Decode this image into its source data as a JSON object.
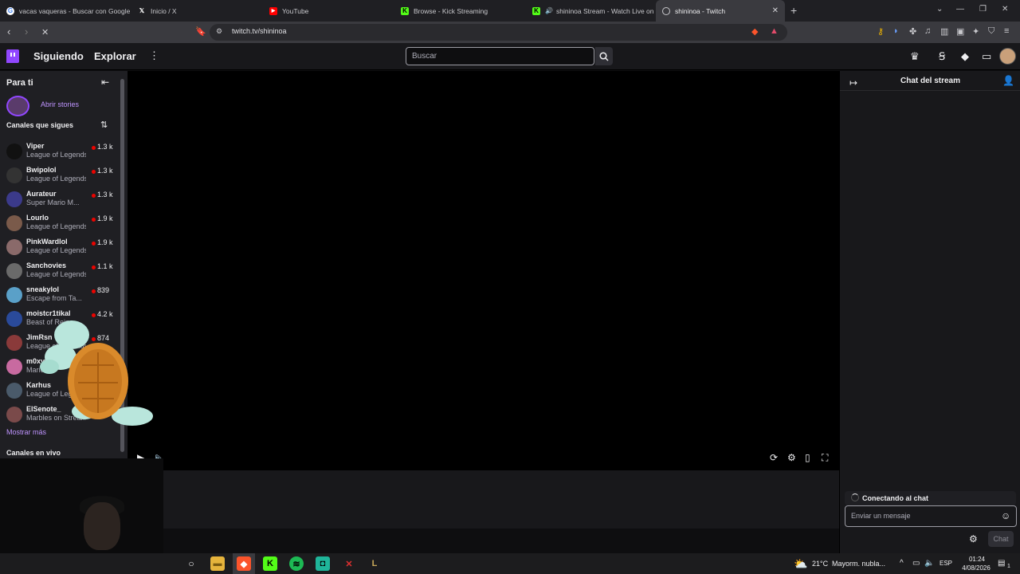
{
  "browser": {
    "tabs": [
      {
        "title": "vacas vaqueras - Buscar con Google",
        "icon": "google-icon",
        "color": "#4285f4"
      },
      {
        "title": "Inicio / X",
        "icon": "x-icon",
        "color": "#ffffff"
      },
      {
        "title": "YouTube",
        "icon": "youtube-icon",
        "color": "#ff0000"
      },
      {
        "title": "Browse - Kick Streaming",
        "icon": "kick-icon",
        "color": "#53fc18"
      },
      {
        "title": "shininoa Stream - Watch Live on",
        "icon": "kick-icon",
        "color": "#53fc18"
      },
      {
        "title": "shininoa - Twitch",
        "icon": "loading-icon",
        "color": "#c8c8cc"
      }
    ],
    "url": "twitch.tv/shininoa"
  },
  "nav": {
    "following": "Siguiendo",
    "explore": "Explorar",
    "search_placeholder": "Buscar"
  },
  "sidebar": {
    "title": "Para ti",
    "stories": "Abrir stories",
    "following_title": "Canales que sigues",
    "channels": [
      {
        "name": "Viper",
        "game": "League of Legends",
        "viewers": "1.3 k",
        "avatar_color": "#111111"
      },
      {
        "name": "Bwipolol",
        "game": "League of Legends",
        "viewers": "1.3 k",
        "avatar_color": "#333333"
      },
      {
        "name": "Aurateur",
        "game": "Super Mario M...",
        "viewers": "1.3 k",
        "avatar_color": "#3b3a8a"
      },
      {
        "name": "Lourlo",
        "game": "League of Legends",
        "viewers": "1.9 k",
        "avatar_color": "#7a5a4a"
      },
      {
        "name": "PinkWardlol",
        "game": "League of Legends",
        "viewers": "1.9 k",
        "avatar_color": "#8a6a6a"
      },
      {
        "name": "Sanchovies",
        "game": "League of Legends",
        "viewers": "1.1 k",
        "avatar_color": "#6a6a6a"
      },
      {
        "name": "sneakylol",
        "game": "Escape from Ta...",
        "viewers": "839",
        "avatar_color": "#5aa0c8"
      },
      {
        "name": "moistcr1tikal",
        "game": "Beast of Reinc...",
        "viewers": "4.2 k",
        "avatar_color": "#2a4a9a"
      },
      {
        "name": "JimRsn",
        "game": "League of Legends",
        "viewers": "874",
        "avatar_color": "#8a3a3a"
      },
      {
        "name": "m0xyy",
        "game": "Mario...",
        "viewers": "",
        "avatar_color": "#c86aa0"
      },
      {
        "name": "Karhus",
        "game": "League of Legends",
        "viewers": "",
        "avatar_color": "#4a5a6a"
      },
      {
        "name": "ElSenote_",
        "game": "Marbles on Stream",
        "viewers": "",
        "avatar_color": "#7a4a4a"
      }
    ],
    "show_more": "Mostrar más",
    "live_title": "Canales en vivo"
  },
  "chat": {
    "title": "Chat del stream",
    "connecting": "Conectando al chat",
    "input_placeholder": "Enviar un mensaje",
    "send_label": "Chat"
  },
  "taskbar": {
    "weather_temp": "21°C",
    "weather_text": "Mayorm. nubla...",
    "lang": "ESP",
    "time": "01:24",
    "date": "4/08/2026",
    "notifications": "1"
  },
  "colors": {
    "accent": "#9147ff",
    "live": "#eb0400"
  }
}
